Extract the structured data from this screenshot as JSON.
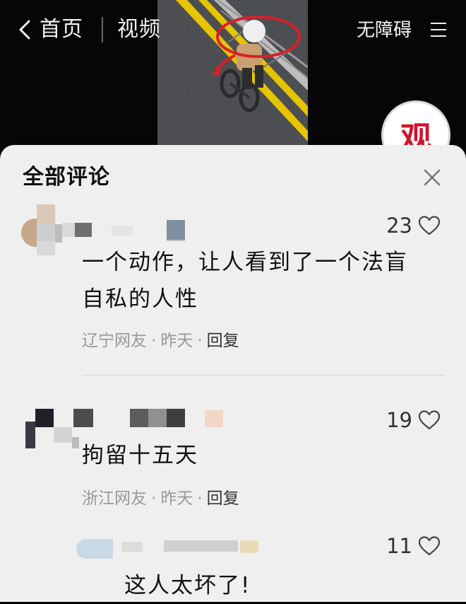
{
  "nav": {
    "back_label": "首页",
    "video_label": "视频",
    "accessibility_label": "无障碍"
  },
  "logo": {
    "text": "观"
  },
  "sheet": {
    "title": "全部评论"
  },
  "comments": [
    {
      "likes": "23",
      "text_line1": "一个动作，让人看到了一个法盲",
      "text_line2": "自私的人性",
      "location": "辽宁网友",
      "time": "昨天",
      "reply": "回复"
    },
    {
      "likes": "19",
      "text": "拘留十五天",
      "location": "浙江网友",
      "time": "昨天",
      "reply": "回复"
    },
    {
      "likes": "11",
      "text": "这人太坏了!"
    }
  ],
  "meta_separator": "·"
}
